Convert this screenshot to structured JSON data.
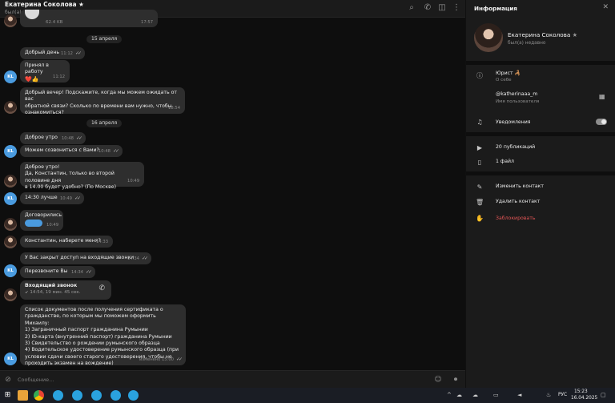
{
  "chat": {
    "title": "Екатерина Соколова ★",
    "status": "был(а) недавно",
    "top_attachment_size": "62.4 KB",
    "top_attachment_time": "17:57",
    "messages": [
      {
        "type": "date",
        "text": "15 апреля"
      },
      {
        "type": "out",
        "text": "Добрый день",
        "time": "11:12"
      },
      {
        "type": "out",
        "text": "Принял в работу",
        "time": "11:12",
        "reactions": "❤️👍"
      },
      {
        "type": "in",
        "text": "Добрый вечер! Подскажите, когда мы можем ожидать от вас\nобратной связи? Сколько по времени вам нужно, чтобы\nознакомиться?",
        "time": "18:54"
      },
      {
        "type": "date",
        "text": "16 апреля"
      },
      {
        "type": "out",
        "text": "Доброе утро",
        "time": "10:48"
      },
      {
        "type": "out",
        "text": "Можем созвониться с Вами?",
        "time": "10:48"
      },
      {
        "type": "in",
        "text": "Доброе утро!\nДа, Константин, только во второй половине дня\nв 14.00 будет удобно? (По Москве)",
        "time": "10:49"
      },
      {
        "type": "out",
        "text": "14:30 лучше",
        "time": "10:49"
      },
      {
        "type": "in",
        "text": "Договорились",
        "time": "10:49"
      },
      {
        "type": "in",
        "text": "Константин, наберете меня?",
        "time": "14:33"
      },
      {
        "type": "out",
        "text": "У Вас закрыт доступ на входящие звонки",
        "time": "14:34"
      },
      {
        "type": "out",
        "text": "Перезвоните Вы",
        "time": "14:34"
      },
      {
        "type": "call",
        "title": "Входящий звонок",
        "detail": "14:54, 19 мин. 45 сек."
      },
      {
        "type": "out",
        "text": "Список документов после получения сертификата о\nгражданстве, по которым мы поможем оформить Михаилу:\n1) Заграничный паспорт гражданина Румынии\n2) ID-карта (внутренний паспорт) гражданина Румынии\n3) Свидетельство о рождении румынского образца\n4) Водительское удостоверение румынского образца (при\nусловии сдачи своего старого удостоверения, чтобы не\nпроходить экзамен на вождение)",
        "time": "изменено 15:00"
      }
    ],
    "avatar_initials": "KL",
    "composer_placeholder": "Сообщение..."
  },
  "info": {
    "title": "Информация",
    "name": "Екатерина Соколова",
    "name_star": "★",
    "status": "был(а) недавно",
    "about_value": "Юрист 🦂",
    "about_label": "О себе",
    "username_value": "@katherinaaa_m",
    "username_label": "Имя пользователя",
    "notifications_label": "Уведомления",
    "notifications_on": true,
    "posts": "20 публикаций",
    "files": "1 файл",
    "edit_contact": "Изменить контакт",
    "delete_contact": "Удалить контакт",
    "block": "Заблокировать"
  },
  "taskbar": {
    "lang": "РУС",
    "time": "15:23",
    "date": "16.04.2025"
  },
  "colors": {
    "bubble": "#2e2e2e",
    "panel": "#1b1b1b",
    "background": "#0e0e0e",
    "accent": "#4a9bdf",
    "danger": "#e25555"
  }
}
